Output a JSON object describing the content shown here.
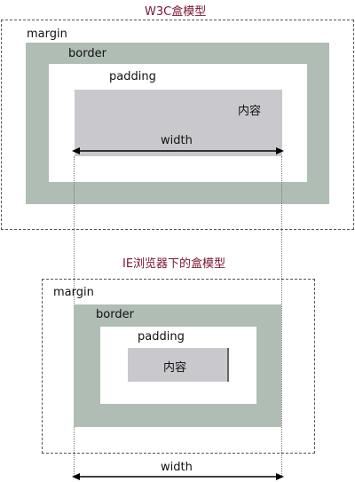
{
  "w3c_model": {
    "title": "W3C盒模型",
    "margin_label": "margin",
    "border_label": "border",
    "padding_label": "padding",
    "content_label": "内容",
    "width_label": "width"
  },
  "ie_model": {
    "title": "IE浏览器下的盒模型",
    "margin_label": "margin",
    "border_label": "border",
    "padding_label": "padding",
    "content_label": "内容",
    "width_label": "width"
  },
  "colors": {
    "title": "#7b1430",
    "border_fill": "#b0bdb5",
    "content_fill": "#c9c9cd",
    "dash_line": "#555555"
  }
}
